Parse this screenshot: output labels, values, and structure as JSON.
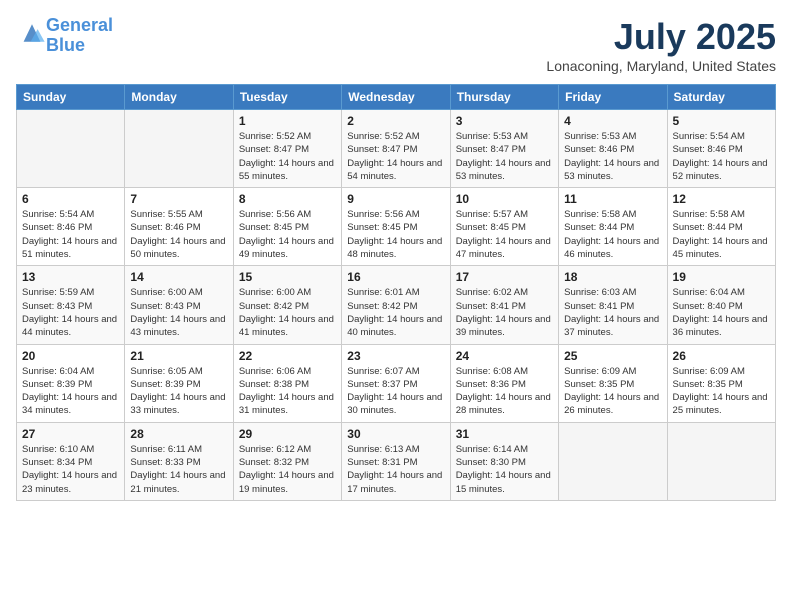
{
  "header": {
    "logo_line1": "General",
    "logo_line2": "Blue",
    "month_title": "July 2025",
    "location": "Lonaconing, Maryland, United States"
  },
  "weekdays": [
    "Sunday",
    "Monday",
    "Tuesday",
    "Wednesday",
    "Thursday",
    "Friday",
    "Saturday"
  ],
  "weeks": [
    [
      {
        "day": "",
        "info": ""
      },
      {
        "day": "",
        "info": ""
      },
      {
        "day": "1",
        "info": "Sunrise: 5:52 AM\nSunset: 8:47 PM\nDaylight: 14 hours and 55 minutes."
      },
      {
        "day": "2",
        "info": "Sunrise: 5:52 AM\nSunset: 8:47 PM\nDaylight: 14 hours and 54 minutes."
      },
      {
        "day": "3",
        "info": "Sunrise: 5:53 AM\nSunset: 8:47 PM\nDaylight: 14 hours and 53 minutes."
      },
      {
        "day": "4",
        "info": "Sunrise: 5:53 AM\nSunset: 8:46 PM\nDaylight: 14 hours and 53 minutes."
      },
      {
        "day": "5",
        "info": "Sunrise: 5:54 AM\nSunset: 8:46 PM\nDaylight: 14 hours and 52 minutes."
      }
    ],
    [
      {
        "day": "6",
        "info": "Sunrise: 5:54 AM\nSunset: 8:46 PM\nDaylight: 14 hours and 51 minutes."
      },
      {
        "day": "7",
        "info": "Sunrise: 5:55 AM\nSunset: 8:46 PM\nDaylight: 14 hours and 50 minutes."
      },
      {
        "day": "8",
        "info": "Sunrise: 5:56 AM\nSunset: 8:45 PM\nDaylight: 14 hours and 49 minutes."
      },
      {
        "day": "9",
        "info": "Sunrise: 5:56 AM\nSunset: 8:45 PM\nDaylight: 14 hours and 48 minutes."
      },
      {
        "day": "10",
        "info": "Sunrise: 5:57 AM\nSunset: 8:45 PM\nDaylight: 14 hours and 47 minutes."
      },
      {
        "day": "11",
        "info": "Sunrise: 5:58 AM\nSunset: 8:44 PM\nDaylight: 14 hours and 46 minutes."
      },
      {
        "day": "12",
        "info": "Sunrise: 5:58 AM\nSunset: 8:44 PM\nDaylight: 14 hours and 45 minutes."
      }
    ],
    [
      {
        "day": "13",
        "info": "Sunrise: 5:59 AM\nSunset: 8:43 PM\nDaylight: 14 hours and 44 minutes."
      },
      {
        "day": "14",
        "info": "Sunrise: 6:00 AM\nSunset: 8:43 PM\nDaylight: 14 hours and 43 minutes."
      },
      {
        "day": "15",
        "info": "Sunrise: 6:00 AM\nSunset: 8:42 PM\nDaylight: 14 hours and 41 minutes."
      },
      {
        "day": "16",
        "info": "Sunrise: 6:01 AM\nSunset: 8:42 PM\nDaylight: 14 hours and 40 minutes."
      },
      {
        "day": "17",
        "info": "Sunrise: 6:02 AM\nSunset: 8:41 PM\nDaylight: 14 hours and 39 minutes."
      },
      {
        "day": "18",
        "info": "Sunrise: 6:03 AM\nSunset: 8:41 PM\nDaylight: 14 hours and 37 minutes."
      },
      {
        "day": "19",
        "info": "Sunrise: 6:04 AM\nSunset: 8:40 PM\nDaylight: 14 hours and 36 minutes."
      }
    ],
    [
      {
        "day": "20",
        "info": "Sunrise: 6:04 AM\nSunset: 8:39 PM\nDaylight: 14 hours and 34 minutes."
      },
      {
        "day": "21",
        "info": "Sunrise: 6:05 AM\nSunset: 8:39 PM\nDaylight: 14 hours and 33 minutes."
      },
      {
        "day": "22",
        "info": "Sunrise: 6:06 AM\nSunset: 8:38 PM\nDaylight: 14 hours and 31 minutes."
      },
      {
        "day": "23",
        "info": "Sunrise: 6:07 AM\nSunset: 8:37 PM\nDaylight: 14 hours and 30 minutes."
      },
      {
        "day": "24",
        "info": "Sunrise: 6:08 AM\nSunset: 8:36 PM\nDaylight: 14 hours and 28 minutes."
      },
      {
        "day": "25",
        "info": "Sunrise: 6:09 AM\nSunset: 8:35 PM\nDaylight: 14 hours and 26 minutes."
      },
      {
        "day": "26",
        "info": "Sunrise: 6:09 AM\nSunset: 8:35 PM\nDaylight: 14 hours and 25 minutes."
      }
    ],
    [
      {
        "day": "27",
        "info": "Sunrise: 6:10 AM\nSunset: 8:34 PM\nDaylight: 14 hours and 23 minutes."
      },
      {
        "day": "28",
        "info": "Sunrise: 6:11 AM\nSunset: 8:33 PM\nDaylight: 14 hours and 21 minutes."
      },
      {
        "day": "29",
        "info": "Sunrise: 6:12 AM\nSunset: 8:32 PM\nDaylight: 14 hours and 19 minutes."
      },
      {
        "day": "30",
        "info": "Sunrise: 6:13 AM\nSunset: 8:31 PM\nDaylight: 14 hours and 17 minutes."
      },
      {
        "day": "31",
        "info": "Sunrise: 6:14 AM\nSunset: 8:30 PM\nDaylight: 14 hours and 15 minutes."
      },
      {
        "day": "",
        "info": ""
      },
      {
        "day": "",
        "info": ""
      }
    ]
  ]
}
